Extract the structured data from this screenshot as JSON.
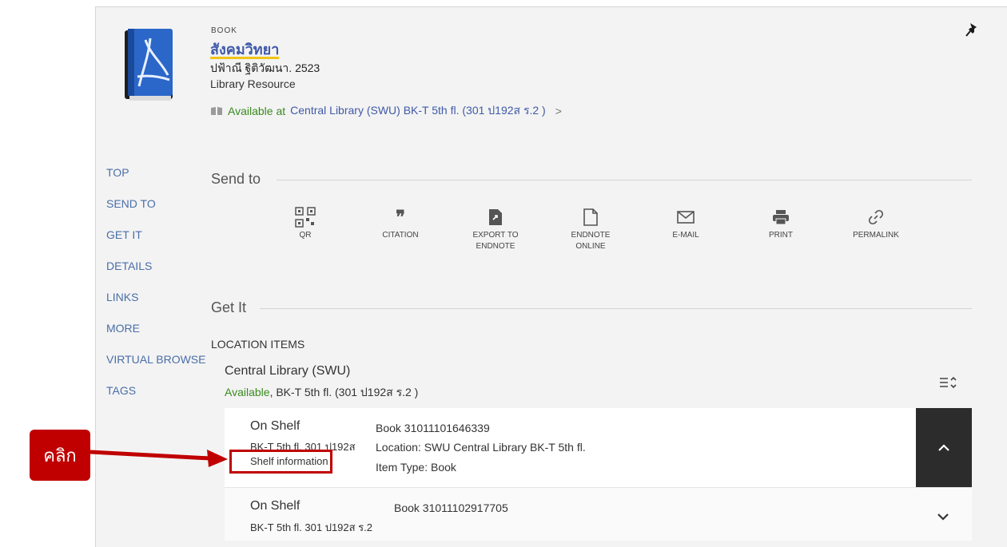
{
  "record": {
    "type": "BOOK",
    "title": "สังคมวิทยา",
    "author": "ปฟ้าณี ฐิติวัฒนา. 2523",
    "resource_type": "Library Resource",
    "availability_status": "Available at",
    "availability_location": "Central Library (SWU)  BK-T 5th fl. (301 ป192ส ร.2 )",
    "availability_chevron": ">"
  },
  "nav": [
    "TOP",
    "SEND TO",
    "GET IT",
    "DETAILS",
    "LINKS",
    "MORE",
    "VIRTUAL BROWSE",
    "TAGS"
  ],
  "send_to": {
    "title": "Send to",
    "items": [
      {
        "label": "QR",
        "icon": "qr-code-icon"
      },
      {
        "label": "CITATION",
        "icon": "quote-icon"
      },
      {
        "label": "EXPORT TO ENDNOTE",
        "icon": "export-file-icon"
      },
      {
        "label": "ENDNOTE ONLINE",
        "icon": "document-icon"
      },
      {
        "label": "E-MAIL",
        "icon": "envelope-icon"
      },
      {
        "label": "PRINT",
        "icon": "printer-icon"
      },
      {
        "label": "PERMALINK",
        "icon": "link-icon"
      }
    ]
  },
  "get_it": {
    "title": "Get It",
    "location_items_label": "LOCATION ITEMS",
    "library_name": "Central Library (SWU)",
    "library_status": "Available",
    "library_detail": ", BK-T 5th fl. (301 ป192ส ร.2 )",
    "items": [
      {
        "status": "On Shelf",
        "call_number": "BK-T 5th fl. 301 ป192ส",
        "shelf_link": "Shelf information",
        "barcode": "Book 31011101646339",
        "location": "Location: SWU Central Library BK-T 5th fl.",
        "item_type": "Item Type: Book"
      },
      {
        "status": "On Shelf",
        "call_number": "BK-T 5th fl. 301 ป192ส ร.2",
        "barcode": "Book 31011102917705"
      }
    ]
  },
  "annotation": {
    "click_label": "คลิก"
  },
  "colors": {
    "accent_blue": "#3f5aa8",
    "available_green": "#3a8a1f",
    "annotation_red": "#c00000"
  }
}
